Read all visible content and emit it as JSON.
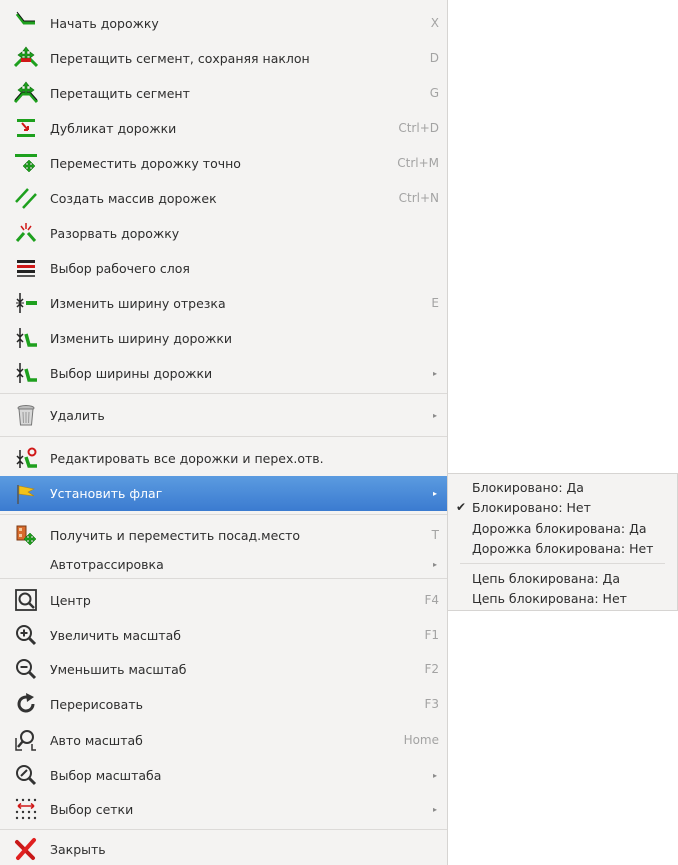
{
  "menu": {
    "items": [
      {
        "label": "Начать дорожку",
        "shortcut": "X",
        "icon": "route-start-icon"
      },
      {
        "label": "Перетащить сегмент, сохраняя наклон",
        "shortcut": "D",
        "icon": "drag-segment-keep-slope-icon"
      },
      {
        "label": "Перетащить сегмент",
        "shortcut": "G",
        "icon": "drag-segment-icon"
      },
      {
        "label": "Дубликат дорожки",
        "shortcut": "Ctrl+D",
        "icon": "duplicate-track-icon"
      },
      {
        "label": "Переместить дорожку точно",
        "shortcut": "Ctrl+M",
        "icon": "move-exact-icon"
      },
      {
        "label": "Создать массив дорожек",
        "shortcut": "Ctrl+N",
        "icon": "track-array-icon"
      },
      {
        "label": "Разорвать дорожку",
        "shortcut": "",
        "icon": "break-track-icon"
      },
      {
        "label": "Выбор рабочего слоя",
        "shortcut": "",
        "icon": "layers-icon"
      },
      {
        "label": "Изменить ширину отрезка",
        "shortcut": "E",
        "icon": "segment-width-icon"
      },
      {
        "label": "Изменить ширину дорожки",
        "shortcut": "",
        "icon": "track-width-icon"
      },
      {
        "label": "Выбор ширины дорожки",
        "shortcut": "",
        "icon": "select-track-width-icon",
        "submenu": true
      },
      {
        "label": "Удалить",
        "shortcut": "",
        "icon": "trash-icon",
        "submenu": true
      },
      {
        "label": "Редактировать все дорожки и перех.отв.",
        "shortcut": "",
        "icon": "edit-tracks-vias-icon"
      },
      {
        "label": "Установить флаг",
        "shortcut": "",
        "icon": "flag-icon",
        "submenu": true,
        "highlighted": true
      },
      {
        "label": "Получить и переместить посад.место",
        "shortcut": "T",
        "icon": "footprint-move-icon"
      },
      {
        "label": "Автотрассировка",
        "shortcut": "",
        "icon": "",
        "submenu": true
      },
      {
        "label": "Центр",
        "shortcut": "F4",
        "icon": "zoom-center-icon"
      },
      {
        "label": "Увеличить масштаб",
        "shortcut": "F1",
        "icon": "zoom-in-icon"
      },
      {
        "label": "Уменьшить масштаб",
        "shortcut": "F2",
        "icon": "zoom-out-icon"
      },
      {
        "label": "Перерисовать",
        "shortcut": "F3",
        "icon": "redraw-icon"
      },
      {
        "label": "Авто масштаб",
        "shortcut": "Home",
        "icon": "zoom-auto-icon"
      },
      {
        "label": "Выбор масштаба",
        "shortcut": "",
        "icon": "zoom-select-icon",
        "submenu": true
      },
      {
        "label": "Выбор сетки",
        "shortcut": "",
        "icon": "grid-icon",
        "submenu": true
      },
      {
        "label": "Закрыть",
        "shortcut": "",
        "icon": "close-icon"
      }
    ]
  },
  "submenu": {
    "items": [
      {
        "label": "Блокировано: Да",
        "checked": false
      },
      {
        "label": "Блокировано: Нет",
        "checked": true
      },
      {
        "label": "Дорожка блокирована: Да",
        "checked": false
      },
      {
        "label": "Дорожка блокирована: Нет",
        "checked": false
      },
      {
        "label": "Цепь блокирована: Да",
        "checked": false
      },
      {
        "label": "Цепь блокирована: Нет",
        "checked": false
      }
    ],
    "check_glyph": "✔"
  },
  "colors": {
    "highlight": "#3b7bd0",
    "track_green": "#1ea01e",
    "track_red": "#d01818"
  },
  "glyphs": {
    "submenu_arrow": "▸"
  }
}
